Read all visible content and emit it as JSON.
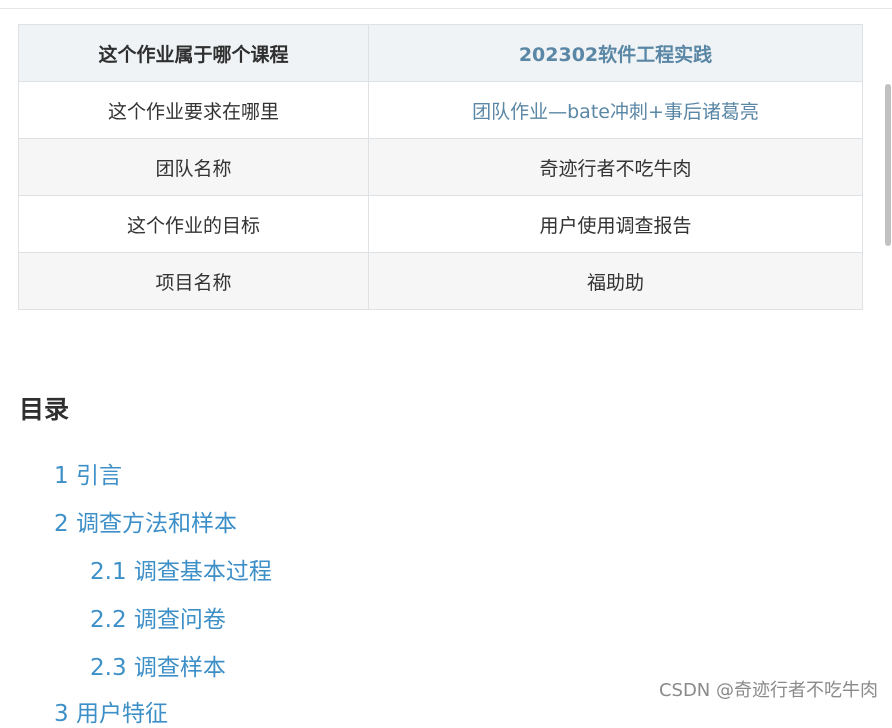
{
  "info_table": {
    "rows": [
      {
        "label": "这个作业属于哪个课程",
        "value": "202302软件工程实践"
      },
      {
        "label": "这个作业要求在哪里",
        "value": "团队作业—bate冲刺+事后诸葛亮"
      },
      {
        "label": "团队名称",
        "value": "奇迹行者不吃牛肉"
      },
      {
        "label": "这个作业的目标",
        "value": "用户使用调查报告"
      },
      {
        "label": "项目名称",
        "value": "福助助"
      }
    ]
  },
  "toc": {
    "title": "目录",
    "items": [
      {
        "text": "1 引言"
      },
      {
        "text": "2 调查方法和样本"
      },
      {
        "text": "2.1 调查基本过程"
      },
      {
        "text": "2.2 调查问卷"
      },
      {
        "text": "2.3 调查样本"
      },
      {
        "text": "3 用户特征"
      }
    ]
  },
  "watermark": "CSDN @奇迹行者不吃牛肉",
  "colors": {
    "link": "#3d8fc8",
    "table_link": "#5a87a6",
    "header_bg": "#eff3f5",
    "alt_row_bg": "#f6f6f6",
    "border": "#dfe2e5"
  }
}
